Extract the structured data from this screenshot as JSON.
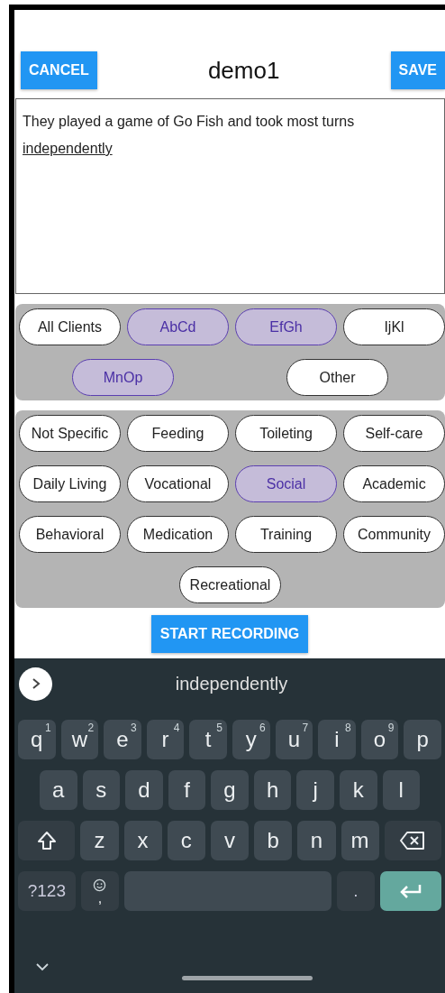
{
  "header": {
    "cancel_button": "CANCEL",
    "title": "demo1",
    "save_button": "SAVE"
  },
  "note": {
    "text": "They played a game of Go Fish and took most turns ",
    "composing_word": "independently"
  },
  "clients": [
    {
      "label": "All Clients",
      "selected": false
    },
    {
      "label": "AbCd",
      "selected": true
    },
    {
      "label": "EfGh",
      "selected": true
    },
    {
      "label": "IjKl",
      "selected": false
    },
    {
      "label": "MnOp",
      "selected": true
    },
    {
      "label": "Other",
      "selected": false
    }
  ],
  "categories": [
    {
      "label": "Not Specific",
      "selected": false
    },
    {
      "label": "Feeding",
      "selected": false
    },
    {
      "label": "Toileting",
      "selected": false
    },
    {
      "label": "Self-care",
      "selected": false
    },
    {
      "label": "Daily Living",
      "selected": false
    },
    {
      "label": "Vocational",
      "selected": false
    },
    {
      "label": "Social",
      "selected": true
    },
    {
      "label": "Academic",
      "selected": false
    },
    {
      "label": "Behavioral",
      "selected": false
    },
    {
      "label": "Medication",
      "selected": false
    },
    {
      "label": "Training",
      "selected": false
    },
    {
      "label": "Community",
      "selected": false
    },
    {
      "label": "Recreational",
      "selected": false
    }
  ],
  "record_button": "START RECORDING",
  "keyboard": {
    "suggestion": "independently",
    "rows": [
      {
        "keys": [
          {
            "kind": "letter",
            "label": "q",
            "hint": "1"
          },
          {
            "kind": "letter",
            "label": "w",
            "hint": "2"
          },
          {
            "kind": "letter",
            "label": "e",
            "hint": "3"
          },
          {
            "kind": "letter",
            "label": "r",
            "hint": "4"
          },
          {
            "kind": "letter",
            "label": "t",
            "hint": "5"
          },
          {
            "kind": "letter",
            "label": "y",
            "hint": "6"
          },
          {
            "kind": "letter",
            "label": "u",
            "hint": "7"
          },
          {
            "kind": "letter",
            "label": "i",
            "hint": "8"
          },
          {
            "kind": "letter",
            "label": "o",
            "hint": "9"
          },
          {
            "kind": "letter",
            "label": "p"
          }
        ]
      },
      {
        "keys": [
          {
            "kind": "letter",
            "label": "a"
          },
          {
            "kind": "letter",
            "label": "s"
          },
          {
            "kind": "letter",
            "label": "d"
          },
          {
            "kind": "letter",
            "label": "f"
          },
          {
            "kind": "letter",
            "label": "g"
          },
          {
            "kind": "letter",
            "label": "h"
          },
          {
            "kind": "letter",
            "label": "j"
          },
          {
            "kind": "letter",
            "label": "k"
          },
          {
            "kind": "letter",
            "label": "l"
          }
        ]
      },
      {
        "keys": [
          {
            "kind": "shift"
          },
          {
            "kind": "letter",
            "label": "z"
          },
          {
            "kind": "letter",
            "label": "x"
          },
          {
            "kind": "letter",
            "label": "c"
          },
          {
            "kind": "letter",
            "label": "v"
          },
          {
            "kind": "letter",
            "label": "b"
          },
          {
            "kind": "letter",
            "label": "n"
          },
          {
            "kind": "letter",
            "label": "m"
          },
          {
            "kind": "backspace"
          }
        ]
      },
      {
        "keys": [
          {
            "kind": "symbols",
            "label": "?123"
          },
          {
            "kind": "emoji",
            "label": ","
          },
          {
            "kind": "space"
          },
          {
            "kind": "period",
            "label": "."
          },
          {
            "kind": "enter"
          }
        ]
      }
    ]
  }
}
